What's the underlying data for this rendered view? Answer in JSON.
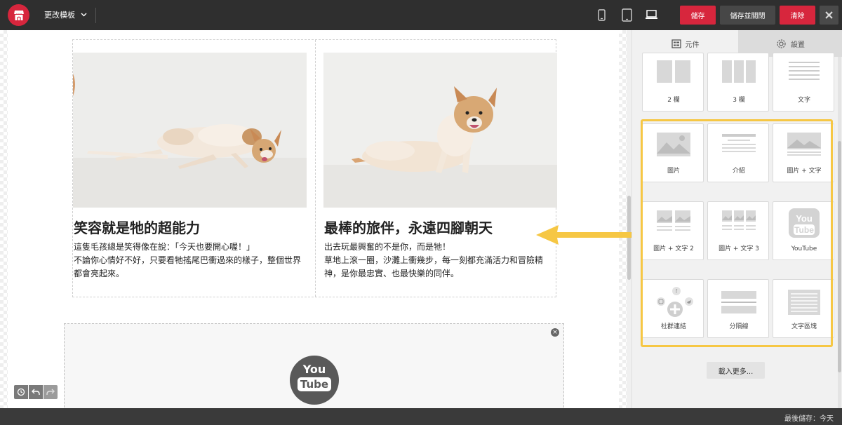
{
  "header": {
    "template_label": "更改模板",
    "devices": [
      "mobile-icon",
      "tablet-icon",
      "desktop-icon"
    ],
    "save_label": "儲存",
    "save_close_label": "儲存並關閉",
    "clear_label": "清除"
  },
  "canvas": {
    "cards": [
      {
        "title": "笑容就是牠的超能力",
        "text": "這隻毛孩總是笑得像在說：「今天也要開心喔！」\n不論你心情好不好，只要看牠搖尾巴衝過來的樣子，整個世界都會亮起來。"
      },
      {
        "title": "最棒的旅伴，永遠四腳朝天",
        "text": "出去玩最興奮的不是你，而是牠！\n草地上滾一圈，沙灘上衝幾步，每一刻都充滿活力和冒險精神，是你最忠實、也最快樂的同伴。"
      }
    ],
    "youtube": {
      "logo_top": "You",
      "logo_bottom": "Tube"
    }
  },
  "panel": {
    "tabs": {
      "elements": "元件",
      "settings": "設置"
    },
    "tiles": [
      {
        "label": "2 欄",
        "icon": "two-column-icon"
      },
      {
        "label": "3 欄",
        "icon": "three-column-icon"
      },
      {
        "label": "文字",
        "icon": "text-icon"
      },
      {
        "label": "圖片",
        "icon": "image-icon"
      },
      {
        "label": "介紹",
        "icon": "intro-icon"
      },
      {
        "label": "圖片 + 文字",
        "icon": "image-text-icon"
      },
      {
        "label": "圖片 + 文字 2",
        "icon": "image-text-2-icon"
      },
      {
        "label": "圖片 + 文字 3",
        "icon": "image-text-3-icon"
      },
      {
        "label": "YouTube",
        "icon": "youtube-icon"
      },
      {
        "label": "社群連結",
        "icon": "social-links-icon"
      },
      {
        "label": "分隔線",
        "icon": "divider-icon"
      },
      {
        "label": "文字區塊",
        "icon": "text-block-icon"
      }
    ],
    "load_more": "載入更多..."
  },
  "status": {
    "last_saved": "最後儲存：今天"
  },
  "colors": {
    "brand_red": "#d7263d",
    "highlight_yellow": "#f6c744",
    "topbar": "#2f2f2f"
  }
}
